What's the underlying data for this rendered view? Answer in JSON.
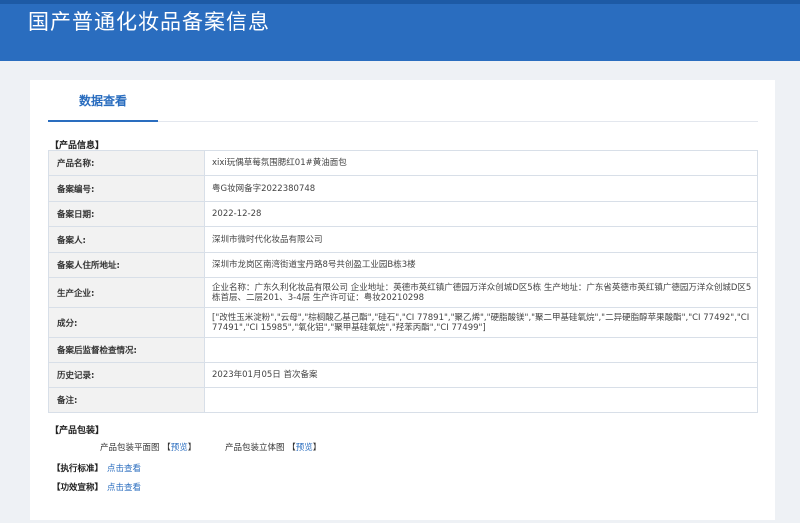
{
  "header": {
    "title": "国产普通化妆品备案信息"
  },
  "tabs": [
    {
      "label": "数据查看"
    }
  ],
  "product_info": {
    "section_title": "【产品信息】",
    "rows": [
      {
        "label": "产品名称:",
        "value": "xixi玩偶草莓氛围腮红01#黄油面包"
      },
      {
        "label": "备案编号:",
        "value": "粤G妆网备字2022380748"
      },
      {
        "label": "备案日期:",
        "value": "2022-12-28"
      },
      {
        "label": "备案人:",
        "value": "深圳市微时代化妆品有限公司"
      },
      {
        "label": "备案人住所地址:",
        "value": "深圳市龙岗区南湾街道宝丹路8号共创盈工业园B栋3楼"
      },
      {
        "label": "生产企业:",
        "value": "企业名称：广东久利化妆品有限公司 企业地址：英德市英红镇广德园万洋众创城D区5栋 生产地址：广东省英德市英红镇广德园万洋众创城D区5栋首层、二层201、3-4层 生产许可证：粤妆20210298"
      },
      {
        "label": "成分:",
        "value": "[\"改性玉米淀粉\",\"云母\",\"棕榈酸乙基己酯\",\"硅石\",\"CI 77891\",\"聚乙烯\",\"硬脂酸镁\",\"聚二甲基硅氧烷\",\"二异硬脂醇苹果酸酯\",\"CI 77492\",\"CI 77491\",\"CI 15985\",\"氧化铝\",\"聚甲基硅氧烷\",\"羟苯丙酯\",\"CI 77499\"]"
      },
      {
        "label": "备案后监督检查情况:",
        "value": ""
      },
      {
        "label": "历史记录:",
        "value": "2023年01月05日 首次备案"
      },
      {
        "label": "备注:",
        "value": ""
      }
    ]
  },
  "packaging": {
    "section_title": "【产品包装】",
    "flat_label": "产品包装平面图",
    "stereo_label": "产品包装立体图",
    "bracket_open": "【",
    "preview_link": "预览",
    "bracket_close": "】"
  },
  "standard": {
    "label": "【执行标准】",
    "link": "点击查看"
  },
  "efficacy": {
    "label": "【功效宣称】",
    "link": "点击查看"
  }
}
